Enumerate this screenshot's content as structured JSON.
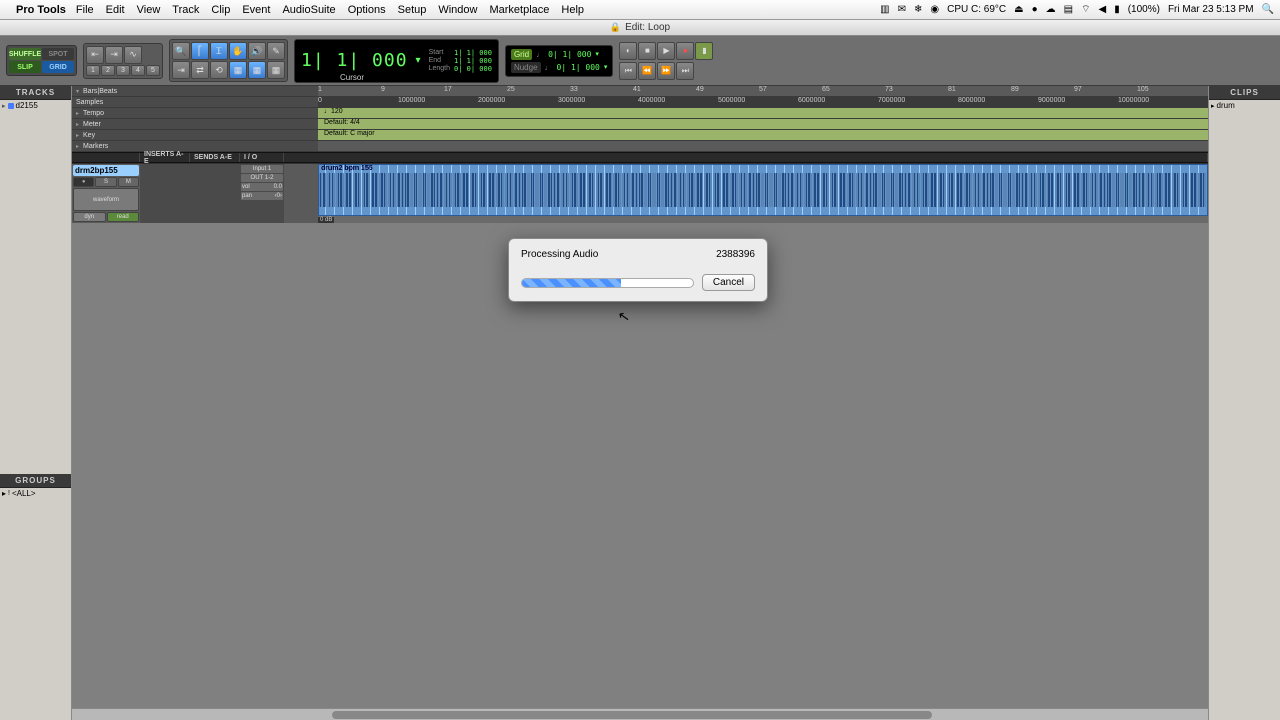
{
  "menubar": {
    "app": "Pro Tools",
    "items": [
      "File",
      "Edit",
      "View",
      "Track",
      "Clip",
      "Event",
      "AudioSuite",
      "Options",
      "Setup",
      "Window",
      "Marketplace",
      "Help"
    ],
    "right": {
      "cpu": "CPU C: 69°C",
      "battery": "(100%)",
      "datetime": "Fri Mar 23  5:13 PM"
    }
  },
  "window": {
    "title": "Edit: Loop"
  },
  "edit_modes": {
    "shuffle": "SHUFFLE",
    "spot": "SPOT",
    "slip": "SLIP",
    "grid": "GRID"
  },
  "track_nums": [
    "1",
    "2",
    "3",
    "4",
    "5"
  ],
  "counter": {
    "main": "1| 1| 000",
    "start_lbl": "Start",
    "start_val": "1| 1| 000",
    "end_lbl": "End",
    "end_val": "1| 1| 000",
    "len_lbl": "Length",
    "len_val": "0| 0| 000",
    "cursor_lbl": "Cursor"
  },
  "gridnudge": {
    "grid_lbl": "Grid",
    "grid_val": "0| 1| 000",
    "nudge_lbl": "Nudge",
    "nudge_val": "0| 1| 000"
  },
  "left": {
    "tracks_hdr": "TRACKS",
    "track_item": "d2155",
    "groups_hdr": "GROUPS",
    "group_item": "<ALL>"
  },
  "right": {
    "clips_hdr": "CLIPS",
    "clip_item": "drum"
  },
  "rulers": {
    "bars_lbl": "Bars|Beats",
    "bars": [
      "1",
      "9",
      "17",
      "25",
      "33",
      "41",
      "49",
      "57",
      "65",
      "73",
      "81",
      "89",
      "97",
      "105"
    ],
    "samples_lbl": "Samples",
    "samples": [
      "0",
      "1000000",
      "2000000",
      "3000000",
      "4000000",
      "5000000",
      "6000000",
      "7000000",
      "8000000",
      "9000000",
      "10000000"
    ],
    "tempo_lbl": "Tempo",
    "tempo_val": "♩120",
    "meter_lbl": "Meter",
    "meter_val": "Default: 4/4",
    "key_lbl": "Key",
    "key_val": "Default: C major",
    "markers_lbl": "Markers"
  },
  "col_headers": {
    "inserts": "INSERTS A-E",
    "sends": "SENDS A-E",
    "io": "I / O"
  },
  "track": {
    "name": "drm2bp155",
    "rec": "●",
    "solo": "S",
    "mute": "M",
    "wave_lbl": "waveform",
    "dyn_lbl": "dyn",
    "read_lbl": "read",
    "io_in": "Input 1",
    "io_out": "OUT 1-2",
    "vol_lbl": "vol",
    "vol_val": "0.0",
    "pan_lbl": "pan",
    "pan_val": "‹0›",
    "db": "0 dB",
    "clip_name": "drum2 bpm 155"
  },
  "dialog": {
    "title": "Processing Audio",
    "value": "2388396",
    "cancel": "Cancel",
    "progress_pct": 58
  }
}
